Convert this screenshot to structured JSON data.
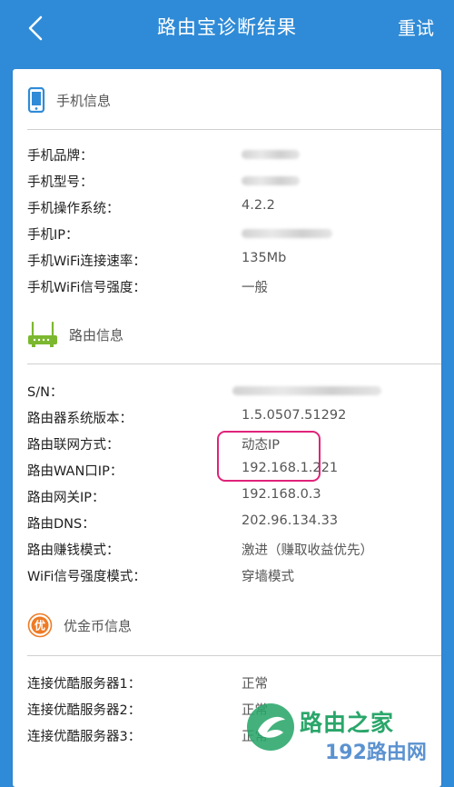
{
  "header": {
    "title": "路由宝诊断结果",
    "retry_label": "重试",
    "back_icon": "chevron-left-icon"
  },
  "colors": {
    "topbar": "#2f8bd7",
    "router_icon": "#7cb82f",
    "coin_icon": "#ef7b24",
    "highlight_border": "#e0237a"
  },
  "sections": {
    "phone": {
      "title": "手机信息",
      "rows": [
        {
          "key": "手机品牌：",
          "value": ""
        },
        {
          "key": "手机型号：",
          "value": ""
        },
        {
          "key": "手机操作系统：",
          "value": "4.2.2"
        },
        {
          "key": "手机IP：",
          "value": ""
        },
        {
          "key": "手机WiFi连接速率：",
          "value": "135Mb"
        },
        {
          "key": "手机WiFi信号强度：",
          "value": "一般"
        }
      ]
    },
    "router": {
      "title": "路由信息",
      "rows": [
        {
          "key": "S/N：",
          "value": ""
        },
        {
          "key": "路由器系统版本：",
          "value": "1.5.0507.51292"
        },
        {
          "key": "路由联网方式：",
          "value": "动态IP"
        },
        {
          "key": "路由WAN口IP：",
          "value": "192.168.1.221"
        },
        {
          "key": "路由网关IP：",
          "value": "192.168.0.3"
        },
        {
          "key": "路由DNS：",
          "value": "202.96.134.33"
        },
        {
          "key": "路由赚钱模式：",
          "value": "激进（赚取收益优先）"
        },
        {
          "key": "WiFi信号强度模式：",
          "value": "穿墙模式"
        }
      ]
    },
    "coins": {
      "title": "优金币信息",
      "icon_glyph": "优",
      "rows": [
        {
          "key": "连接优酷服务器1：",
          "value": "正常"
        },
        {
          "key": "连接优酷服务器2：",
          "value": "正常"
        },
        {
          "key": "连接优酷服务器3：",
          "value": "正常"
        }
      ]
    }
  },
  "watermark": {
    "text": "路由之家",
    "url": "192路由网"
  }
}
